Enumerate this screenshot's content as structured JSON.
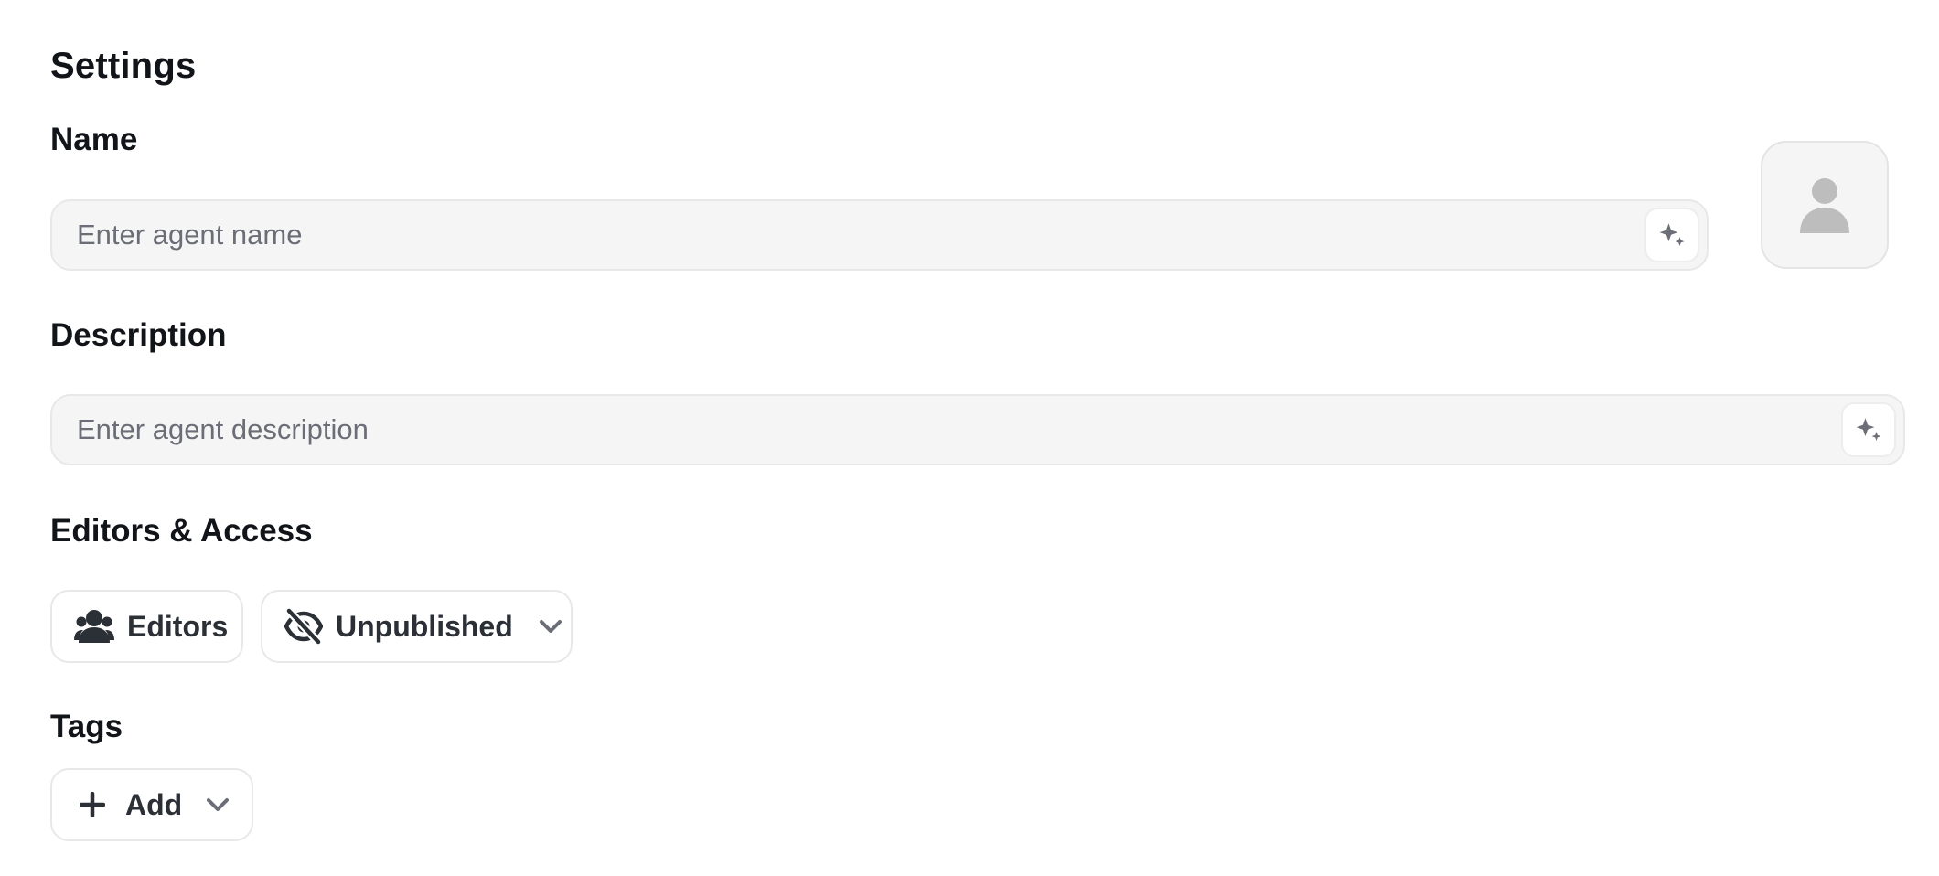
{
  "page": {
    "title": "Settings"
  },
  "name_section": {
    "label": "Name",
    "placeholder": "Enter agent name",
    "value": "",
    "generate_icon": "sparkle-icon"
  },
  "avatar": {
    "icon": "user-icon"
  },
  "description_section": {
    "label": "Description",
    "placeholder": "Enter agent description",
    "value": "",
    "generate_icon": "sparkle-icon"
  },
  "access_section": {
    "label": "Editors & Access",
    "editors_button": {
      "label": "Editors",
      "icon": "users-icon"
    },
    "visibility_dropdown": {
      "label": "Unpublished",
      "icon": "eye-slash-icon",
      "chevron_icon": "chevron-down-icon"
    }
  },
  "tags_section": {
    "label": "Tags",
    "add_button": {
      "label": "Add",
      "icon": "plus-icon",
      "chevron_icon": "chevron-down-icon"
    }
  },
  "colors": {
    "text_primary": "#111418",
    "button_text": "#2b2f36",
    "placeholder": "#6b6e76",
    "field_background": "#f5f5f5",
    "border": "#e8e8e8",
    "icon_muted": "#6b6e76",
    "avatar_icon": "#bdbdbd"
  }
}
